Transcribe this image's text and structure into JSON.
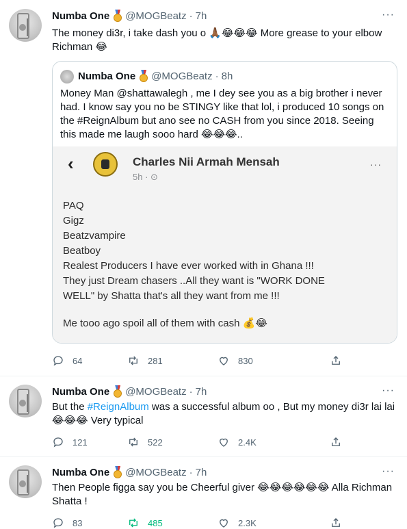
{
  "tweets": [
    {
      "name": "Numba One",
      "handle": "@MOGBeatz",
      "time": "7h",
      "text": "The money di3r, i take dash you o 🙏🏾😂😂😂 More grease to your elbow Richman 😂",
      "quote": {
        "name": "Numba One",
        "handle": "@MOGBeatz",
        "time": "8h",
        "text": "Money Man @shattawalegh , me I dey see you as a big brother i never had. I know say you no be STINGY like that lol, i produced 10 songs on the #ReignAlbum but ano see no CASH from you since 2018. Seeing this made me laugh sooo hard 😂😂😂..",
        "screenshot": {
          "page_name": "Charles Nii Armah Mensah",
          "time": "5h · ⊙",
          "lines": [
            "PAQ",
            "Gigz",
            "Beatzvampire",
            "Beatboy",
            "Realest Producers I have ever worked with in Ghana !!!",
            "They just Dream chasers ..All they want is \"WORK DONE",
            "WELL\" by Shatta that's all they want from me !!!",
            "",
            "Me tooo ago spoil all of them with cash 💰😂"
          ]
        }
      },
      "replies": "64",
      "retweets": "281",
      "likes": "830"
    },
    {
      "name": "Numba One",
      "handle": "@MOGBeatz",
      "time": "7h",
      "text_before": "But the ",
      "hashtag": "#ReignAlbum",
      "text_after": " was a successful album oo , But my money di3r lai lai 😂😂😂 Very typical",
      "replies": "121",
      "retweets": "522",
      "likes": "2.4K"
    },
    {
      "name": "Numba One",
      "handle": "@MOGBeatz",
      "time": "7h",
      "text": "Then People figga say you be Cheerful giver 😂😂😂😂😂😂 Alla Richman Shatta !",
      "replies": "83",
      "retweets": "485",
      "likes": "2.3K"
    }
  ],
  "separator": "·",
  "more_glyph": "···",
  "back_glyph": "‹",
  "colors": {
    "accent": "#1d9bf0",
    "retweet_active": "#00ba7c",
    "muted": "#536471",
    "border": "#cfd9de"
  }
}
